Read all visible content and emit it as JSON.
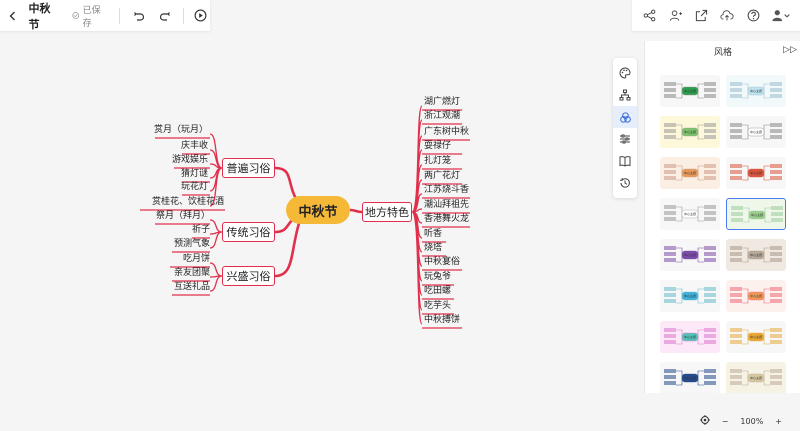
{
  "topbar": {
    "back_icon": "chevron-left-icon",
    "title": "中秋节",
    "saved_status": "已保存",
    "undo_icon": "undo-icon",
    "redo_icon": "redo-icon",
    "play_icon": "play-circle-icon"
  },
  "topbar_right": {
    "icons": [
      "share-icon",
      "add-collaborator-icon",
      "export-icon",
      "cloud-upload-icon",
      "help-icon",
      "user-menu-icon"
    ]
  },
  "mindmap": {
    "root": "中秋节",
    "branches_left": [
      {
        "label": "普遍习俗",
        "items": [
          "赏月（玩月）",
          "庆丰收",
          "游戏娱乐",
          "猜灯谜",
          "玩花灯",
          "赏桂花、饮桂花酒"
        ]
      },
      {
        "label": "传统习俗",
        "items": [
          "祭月（拜月）",
          "祈子",
          "预测气象"
        ]
      },
      {
        "label": "兴盛习俗",
        "items": [
          "吃月饼",
          "亲友团聚",
          "互送礼品"
        ]
      }
    ],
    "branch_right": {
      "label": "地方特色",
      "items": [
        "湖广燃灯",
        "浙江观潮",
        "广东树中秋",
        "耍禄仔",
        "扎灯笼",
        "两广花灯",
        "江苏烧斗香",
        "潮汕拜祖先",
        "香港舞火龙",
        "听香",
        "烧塔",
        "中秋宴俗",
        "玩兔爷",
        "吃田螺",
        "吃芋头",
        "中秋搏饼"
      ]
    },
    "line_color": "#e0304b",
    "root_color": "#f5b937"
  },
  "side_toolbar": {
    "icons": [
      "palette-icon",
      "structure-icon",
      "theme-icon",
      "settings-icon",
      "outline-icon",
      "history-icon"
    ],
    "active": 2
  },
  "style_panel": {
    "title": "风格",
    "expand_label": "▷▷",
    "thumb_label": "中心主题",
    "selected_index": 7
  },
  "zoom": {
    "fit_icon": "locate-icon",
    "minus": "−",
    "level": "100%",
    "plus": "+"
  }
}
